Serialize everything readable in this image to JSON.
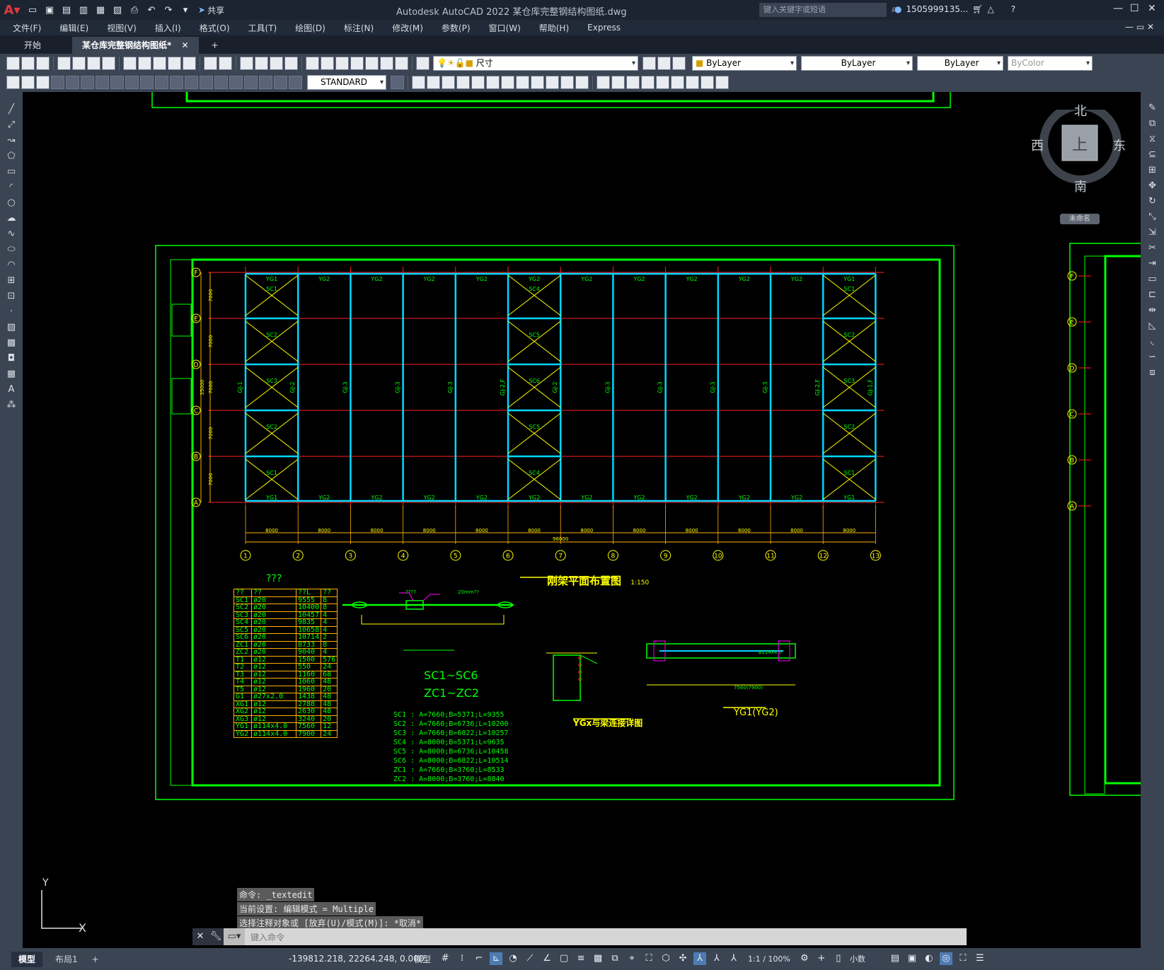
{
  "app": {
    "title": "Autodesk AutoCAD 2022    某仓库完整钢结构图纸.dwg",
    "share_label": "共享",
    "search_placeholder": "键入关键字或短语",
    "user": "1505999135..."
  },
  "menu": [
    "文件(F)",
    "编辑(E)",
    "视图(V)",
    "插入(I)",
    "格式(O)",
    "工具(T)",
    "绘图(D)",
    "标注(N)",
    "修改(M)",
    "参数(P)",
    "窗口(W)",
    "帮助(H)",
    "Express"
  ],
  "tabs": {
    "start": "开始",
    "doc": "某仓库完整钢结构图纸*",
    "close": "✕",
    "add": "+"
  },
  "properties": {
    "layer": "尺寸",
    "color": "ByLayer",
    "linetype": "ByLayer",
    "lineweight": "ByLayer",
    "plotstyle": "ByColor",
    "textstyle": "STANDARD"
  },
  "viewcube": {
    "north": "北",
    "south": "南",
    "east": "东",
    "west": "西",
    "top": "上",
    "view_name": "未命名"
  },
  "ucs": {
    "y": "Y",
    "x": "X"
  },
  "command": {
    "history": [
      "命令: _textedit",
      "当前设置: 编辑模式 = Multiple",
      "选择注释对象或 [放弃(U)/模式(M)]: *取消*"
    ],
    "placeholder": "键入命令"
  },
  "status": {
    "coords": "-139812.218, 22264.248, 0.000",
    "model_label": "模型",
    "tabs": [
      "模型",
      "布局1"
    ],
    "scale": "1:1 / 100%",
    "units": "小数"
  },
  "drawing": {
    "title": "刚架平面布置图",
    "title_scale": "1:150",
    "grid_rows": [
      "F",
      "E",
      "D",
      "C",
      "B",
      "A"
    ],
    "grid_cols": [
      "1",
      "2",
      "3",
      "4",
      "5",
      "6",
      "7",
      "8",
      "9",
      "10",
      "11",
      "12",
      "13"
    ],
    "row_dims": [
      "7000",
      "7000",
      "7000",
      "7000",
      "7000"
    ],
    "row_total": "35000",
    "col_dims": [
      "8000",
      "8000",
      "8000",
      "8000",
      "8000",
      "8000",
      "8000",
      "8000",
      "8000",
      "8000",
      "8000",
      "8000"
    ],
    "col_total": "96000",
    "frame_labels": [
      "GJ-1",
      "GJ-2",
      "GJ-3",
      "GJ-3",
      "GJ-3",
      "GJ-2,F",
      "GJ-2",
      "GJ-3",
      "GJ-3",
      "GJ-3",
      "GJ-3",
      "GJ-2,F",
      "GJ-1,F"
    ],
    "top_beams": [
      "YG1",
      "YG2",
      "YG2",
      "YG2",
      "YG2",
      "YG2",
      "YG2",
      "YG2",
      "YG2",
      "YG2",
      "YG2",
      "YG1"
    ],
    "bracing_left": [
      "SC1",
      "SC2",
      "SC3",
      "SC2",
      "SC1"
    ],
    "bracing_mid": [
      "SC4",
      "SC5",
      "SC6",
      "SC5",
      "SC4"
    ],
    "table_title": "???",
    "table_headers": [
      "??",
      "??",
      "??L",
      "??"
    ],
    "table_rows": [
      [
        "SC1",
        "ø20",
        "9555",
        "8"
      ],
      [
        "SC2",
        "ø20",
        "10400",
        "8"
      ],
      [
        "SC3",
        "ø20",
        "10457",
        "4"
      ],
      [
        "SC4",
        "ø20",
        "9835",
        "4"
      ],
      [
        "SC5",
        "ø20",
        "10658",
        "4"
      ],
      [
        "SC6",
        "ø20",
        "10714",
        "2"
      ],
      [
        "ZC1",
        "ø20",
        "8733",
        "8"
      ],
      [
        "ZC2",
        "ø20",
        "9040",
        "4"
      ],
      [
        "T1",
        "ø12",
        "1500",
        "576"
      ],
      [
        "T2",
        "ø12",
        "550",
        "24"
      ],
      [
        "T3",
        "ø12",
        "1160",
        "68"
      ],
      [
        "T4",
        "ø12",
        "1060",
        "48"
      ],
      [
        "T5",
        "ø12",
        "1960",
        "20"
      ],
      [
        "G1",
        "ø27x2.0",
        "1438",
        "48"
      ],
      [
        "XG1",
        "ø12",
        "2788",
        "48"
      ],
      [
        "XG2",
        "ø12",
        "2630",
        "48"
      ],
      [
        "XG3",
        "ø12",
        "3240",
        "20"
      ],
      [
        "YG1",
        "ø114x4.0",
        "7560",
        "12"
      ],
      [
        "YG2",
        "ø114x4.0",
        "7900",
        "24"
      ]
    ],
    "sc_title1": "SC1~SC6",
    "sc_title2": "ZC1~ZC2",
    "sc_lines": [
      "SC1 : A=7660;B=5371;L=9355",
      "SC2 : A=7660;B=6736;L=10200",
      "SC3 : A=7660;B=6822;L=10257",
      "SC4 : A=8000;B=5371;L=9635",
      "SC5 : A=8000;B=6736;L=10458",
      "SC6 : A=8000;B=6822;L=10514",
      "ZC1 : A=7660;B=3760;L=8533",
      "ZC2 : A=8000;B=3760;L=8840"
    ],
    "detail1_title": "YGx与梁连接详图",
    "detail2_title": "YG1(YG2)",
    "detail_note1": "20mm??",
    "detail_note2": "????",
    "detail_dim1": "ø114x4.0",
    "detail_dim2": "7560(7900)"
  },
  "colors": {
    "green": "#00ff00",
    "cyan": "#00d8ff",
    "red": "#ff2020",
    "yellow": "#ffff00",
    "orange": "#ffb000",
    "magenta": "#ff00ff"
  }
}
